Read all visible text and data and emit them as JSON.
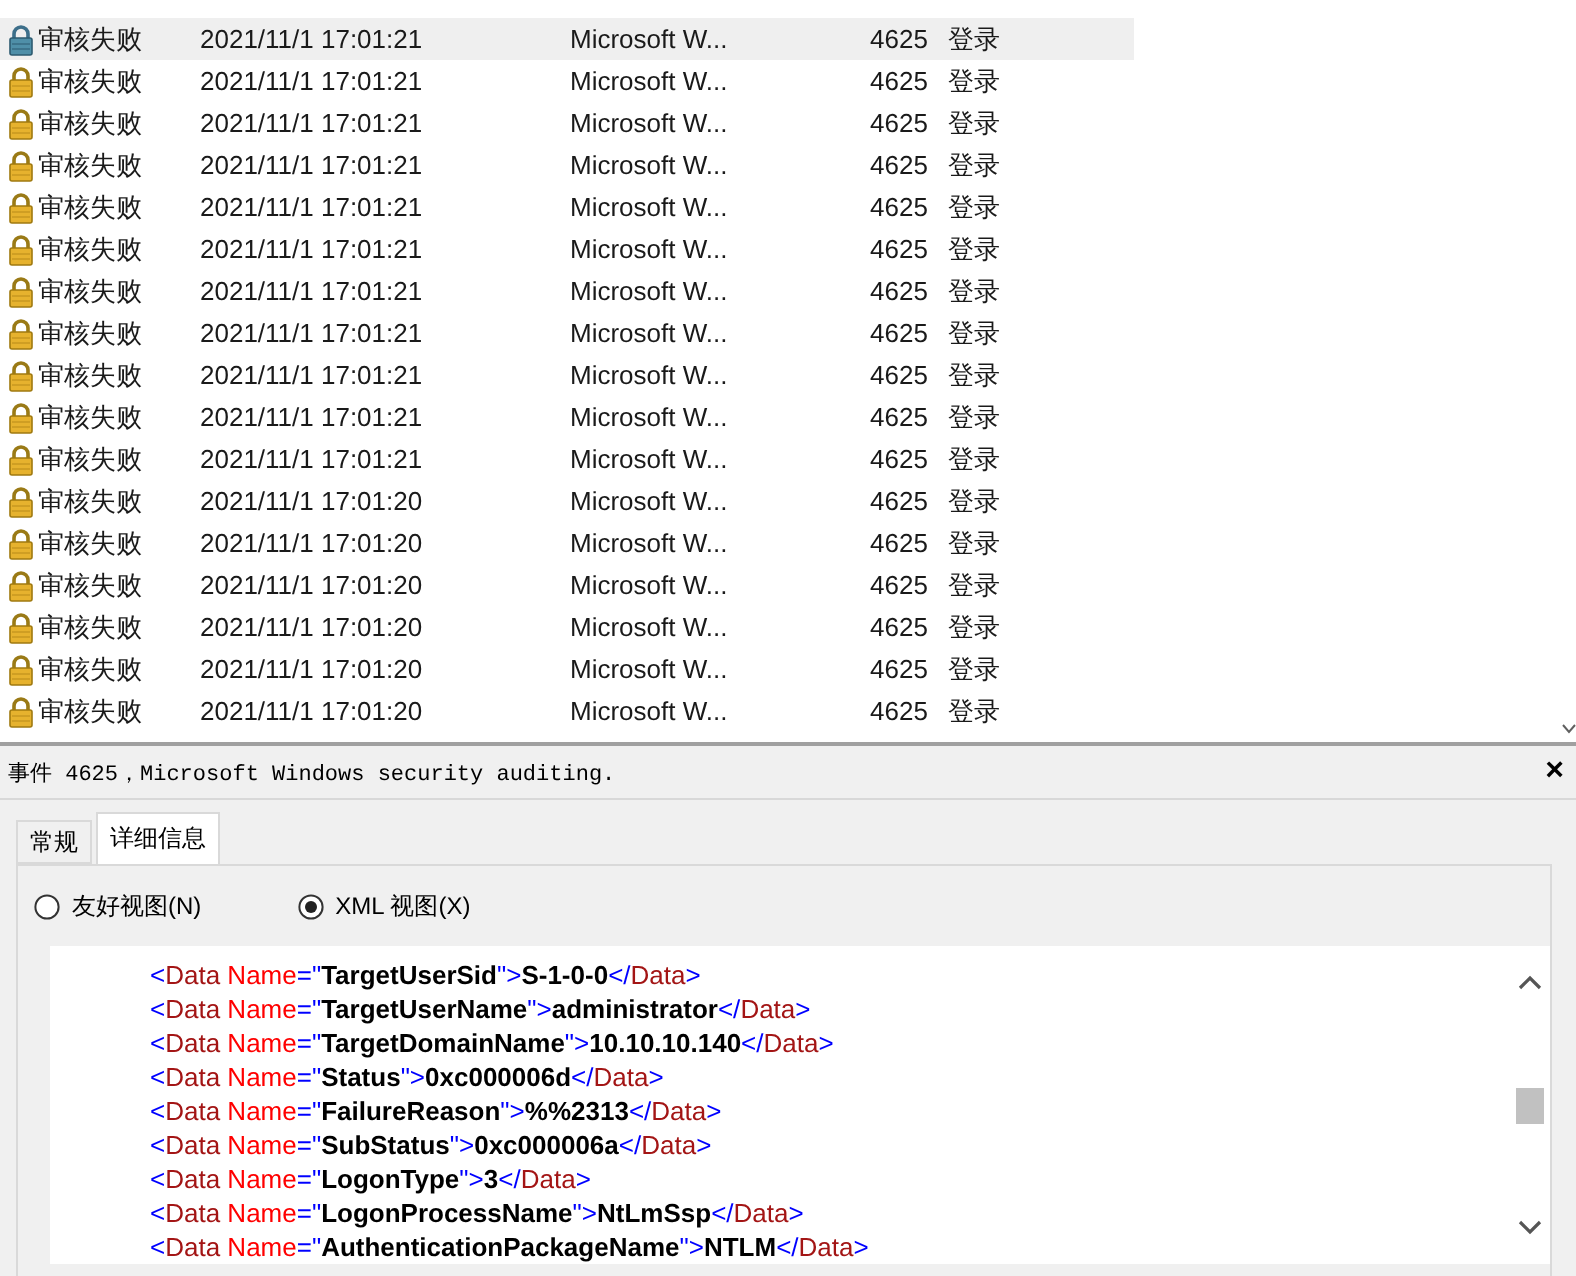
{
  "event_list": {
    "rows": [
      {
        "level": "审核失败",
        "date": "2021/11/1 17:01:21",
        "source": "Microsoft W...",
        "event_id": "4625",
        "category": "登录",
        "selected": true
      },
      {
        "level": "审核失败",
        "date": "2021/11/1 17:01:21",
        "source": "Microsoft W...",
        "event_id": "4625",
        "category": "登录",
        "selected": false
      },
      {
        "level": "审核失败",
        "date": "2021/11/1 17:01:21",
        "source": "Microsoft W...",
        "event_id": "4625",
        "category": "登录",
        "selected": false
      },
      {
        "level": "审核失败",
        "date": "2021/11/1 17:01:21",
        "source": "Microsoft W...",
        "event_id": "4625",
        "category": "登录",
        "selected": false
      },
      {
        "level": "审核失败",
        "date": "2021/11/1 17:01:21",
        "source": "Microsoft W...",
        "event_id": "4625",
        "category": "登录",
        "selected": false
      },
      {
        "level": "审核失败",
        "date": "2021/11/1 17:01:21",
        "source": "Microsoft W...",
        "event_id": "4625",
        "category": "登录",
        "selected": false
      },
      {
        "level": "审核失败",
        "date": "2021/11/1 17:01:21",
        "source": "Microsoft W...",
        "event_id": "4625",
        "category": "登录",
        "selected": false
      },
      {
        "level": "审核失败",
        "date": "2021/11/1 17:01:21",
        "source": "Microsoft W...",
        "event_id": "4625",
        "category": "登录",
        "selected": false
      },
      {
        "level": "审核失败",
        "date": "2021/11/1 17:01:21",
        "source": "Microsoft W...",
        "event_id": "4625",
        "category": "登录",
        "selected": false
      },
      {
        "level": "审核失败",
        "date": "2021/11/1 17:01:21",
        "source": "Microsoft W...",
        "event_id": "4625",
        "category": "登录",
        "selected": false
      },
      {
        "level": "审核失败",
        "date": "2021/11/1 17:01:21",
        "source": "Microsoft W...",
        "event_id": "4625",
        "category": "登录",
        "selected": false
      },
      {
        "level": "审核失败",
        "date": "2021/11/1 17:01:20",
        "source": "Microsoft W...",
        "event_id": "4625",
        "category": "登录",
        "selected": false
      },
      {
        "level": "审核失败",
        "date": "2021/11/1 17:01:20",
        "source": "Microsoft W...",
        "event_id": "4625",
        "category": "登录",
        "selected": false
      },
      {
        "level": "审核失败",
        "date": "2021/11/1 17:01:20",
        "source": "Microsoft W...",
        "event_id": "4625",
        "category": "登录",
        "selected": false
      },
      {
        "level": "审核失败",
        "date": "2021/11/1 17:01:20",
        "source": "Microsoft W...",
        "event_id": "4625",
        "category": "登录",
        "selected": false
      },
      {
        "level": "审核失败",
        "date": "2021/11/1 17:01:20",
        "source": "Microsoft W...",
        "event_id": "4625",
        "category": "登录",
        "selected": false
      },
      {
        "level": "审核失败",
        "date": "2021/11/1 17:01:20",
        "source": "Microsoft W...",
        "event_id": "4625",
        "category": "登录",
        "selected": false
      }
    ]
  },
  "detail": {
    "title": "事件 4625，Microsoft Windows security auditing.",
    "close": "×",
    "tabs": [
      {
        "label": "常规",
        "selected": false
      },
      {
        "label": "详细信息",
        "selected": true
      }
    ],
    "views": [
      {
        "label": "友好视图(N)",
        "selected": false
      },
      {
        "label": "XML 视图(X)",
        "selected": true
      }
    ],
    "xml_lines": [
      {
        "tokens": [
          {
            "kind": "punct",
            "text": "<"
          },
          {
            "kind": "tag",
            "text": "Data"
          },
          {
            "kind": "attr",
            "text": " Name"
          },
          {
            "kind": "punct",
            "text": "=\""
          },
          {
            "kind": "value",
            "text": "TargetUserSid"
          },
          {
            "kind": "punct",
            "text": "\">"
          },
          {
            "kind": "value",
            "text": "S-1-0-0"
          },
          {
            "kind": "punct",
            "text": "</"
          },
          {
            "kind": "tag",
            "text": "Data"
          },
          {
            "kind": "punct",
            "text": ">"
          }
        ]
      },
      {
        "tokens": [
          {
            "kind": "punct",
            "text": "<"
          },
          {
            "kind": "tag",
            "text": "Data"
          },
          {
            "kind": "attr",
            "text": " Name"
          },
          {
            "kind": "punct",
            "text": "=\""
          },
          {
            "kind": "value",
            "text": "TargetUserName"
          },
          {
            "kind": "punct",
            "text": "\">"
          },
          {
            "kind": "value",
            "text": "administrator"
          },
          {
            "kind": "punct",
            "text": "</"
          },
          {
            "kind": "tag",
            "text": "Data"
          },
          {
            "kind": "punct",
            "text": ">"
          }
        ]
      },
      {
        "tokens": [
          {
            "kind": "punct",
            "text": "<"
          },
          {
            "kind": "tag",
            "text": "Data"
          },
          {
            "kind": "attr",
            "text": " Name"
          },
          {
            "kind": "punct",
            "text": "=\""
          },
          {
            "kind": "value",
            "text": "TargetDomainName"
          },
          {
            "kind": "punct",
            "text": "\">"
          },
          {
            "kind": "value",
            "text": "10.10.10.140"
          },
          {
            "kind": "punct",
            "text": "</"
          },
          {
            "kind": "tag",
            "text": "Data"
          },
          {
            "kind": "punct",
            "text": ">"
          }
        ]
      },
      {
        "tokens": [
          {
            "kind": "punct",
            "text": "<"
          },
          {
            "kind": "tag",
            "text": "Data"
          },
          {
            "kind": "attr",
            "text": " Name"
          },
          {
            "kind": "punct",
            "text": "=\""
          },
          {
            "kind": "value",
            "text": "Status"
          },
          {
            "kind": "punct",
            "text": "\">"
          },
          {
            "kind": "value",
            "text": "0xc000006d"
          },
          {
            "kind": "punct",
            "text": "</"
          },
          {
            "kind": "tag",
            "text": "Data"
          },
          {
            "kind": "punct",
            "text": ">"
          }
        ]
      },
      {
        "tokens": [
          {
            "kind": "punct",
            "text": "<"
          },
          {
            "kind": "tag",
            "text": "Data"
          },
          {
            "kind": "attr",
            "text": " Name"
          },
          {
            "kind": "punct",
            "text": "=\""
          },
          {
            "kind": "value",
            "text": "FailureReason"
          },
          {
            "kind": "punct",
            "text": "\">"
          },
          {
            "kind": "value",
            "text": "%%2313"
          },
          {
            "kind": "punct",
            "text": "</"
          },
          {
            "kind": "tag",
            "text": "Data"
          },
          {
            "kind": "punct",
            "text": ">"
          }
        ]
      },
      {
        "tokens": [
          {
            "kind": "punct",
            "text": "<"
          },
          {
            "kind": "tag",
            "text": "Data"
          },
          {
            "kind": "attr",
            "text": " Name"
          },
          {
            "kind": "punct",
            "text": "=\""
          },
          {
            "kind": "value",
            "text": "SubStatus"
          },
          {
            "kind": "punct",
            "text": "\">"
          },
          {
            "kind": "value",
            "text": "0xc000006a"
          },
          {
            "kind": "punct",
            "text": "</"
          },
          {
            "kind": "tag",
            "text": "Data"
          },
          {
            "kind": "punct",
            "text": ">"
          }
        ]
      },
      {
        "tokens": [
          {
            "kind": "punct",
            "text": "<"
          },
          {
            "kind": "tag",
            "text": "Data"
          },
          {
            "kind": "attr",
            "text": " Name"
          },
          {
            "kind": "punct",
            "text": "=\""
          },
          {
            "kind": "value",
            "text": "LogonType"
          },
          {
            "kind": "punct",
            "text": "\">"
          },
          {
            "kind": "value",
            "text": "3"
          },
          {
            "kind": "punct",
            "text": "</"
          },
          {
            "kind": "tag",
            "text": "Data"
          },
          {
            "kind": "punct",
            "text": ">"
          }
        ]
      },
      {
        "tokens": [
          {
            "kind": "punct",
            "text": "<"
          },
          {
            "kind": "tag",
            "text": "Data"
          },
          {
            "kind": "attr",
            "text": " Name"
          },
          {
            "kind": "punct",
            "text": "=\""
          },
          {
            "kind": "value",
            "text": "LogonProcessName"
          },
          {
            "kind": "punct",
            "text": "\">"
          },
          {
            "kind": "value",
            "text": "NtLmSsp"
          },
          {
            "kind": "punct",
            "text": "</"
          },
          {
            "kind": "tag",
            "text": "Data"
          },
          {
            "kind": "punct",
            "text": ">"
          }
        ]
      },
      {
        "tokens": [
          {
            "kind": "punct",
            "text": "<"
          },
          {
            "kind": "tag",
            "text": "Data"
          },
          {
            "kind": "attr",
            "text": " Name"
          },
          {
            "kind": "punct",
            "text": "=\""
          },
          {
            "kind": "value",
            "text": "AuthenticationPackageName"
          },
          {
            "kind": "punct",
            "text": "\">"
          },
          {
            "kind": "value",
            "text": "NTLM"
          },
          {
            "kind": "punct",
            "text": "</"
          },
          {
            "kind": "tag",
            "text": "Data"
          },
          {
            "kind": "punct",
            "text": ">"
          }
        ]
      }
    ]
  }
}
